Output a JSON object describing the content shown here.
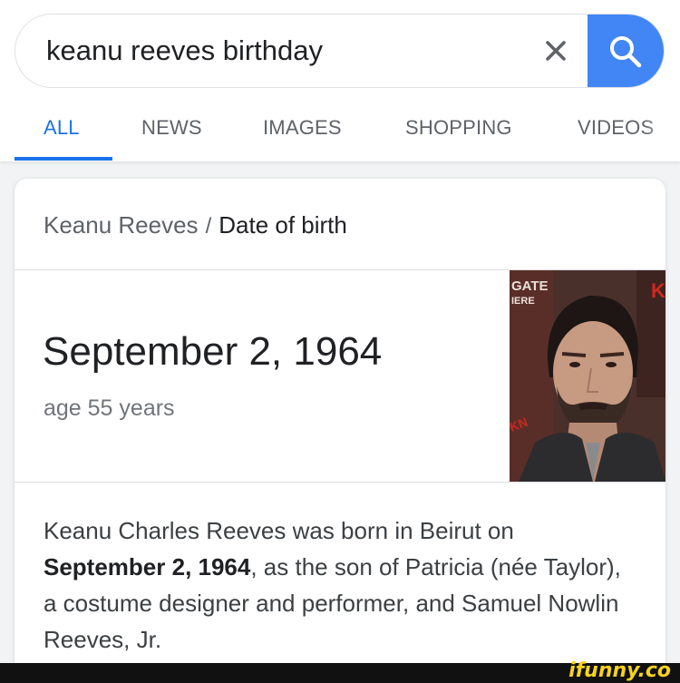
{
  "search": {
    "query": "keanu reeves birthday"
  },
  "tabs": [
    {
      "label": "ALL",
      "active": true
    },
    {
      "label": "NEWS",
      "active": false
    },
    {
      "label": "IMAGES",
      "active": false
    },
    {
      "label": "SHOPPING",
      "active": false
    },
    {
      "label": "VIDEOS",
      "active": false
    }
  ],
  "card": {
    "breadcrumb": {
      "parent": "Keanu Reeves",
      "separator": "/",
      "current": "Date of birth"
    },
    "answer": "September 2, 1964",
    "age": "age 55 years",
    "description": {
      "part1": "Keanu Charles Reeves was born in Beirut on ",
      "bold": "September 2, 1964",
      "part2": ", as the son of Patricia (née Taylor), a costume designer and performer, and Samuel Nowlin Reeves, Jr."
    }
  },
  "photo_text": {
    "sign_top": "GATE",
    "sign_bottom": "IERE",
    "sign_right": "K",
    "sign_side": "KN"
  },
  "watermark": "ifunny.co",
  "colors": {
    "accent": "#1a73e8",
    "search_button": "#4285f4"
  },
  "icons": {
    "clear": "close-icon",
    "search": "search-icon"
  }
}
